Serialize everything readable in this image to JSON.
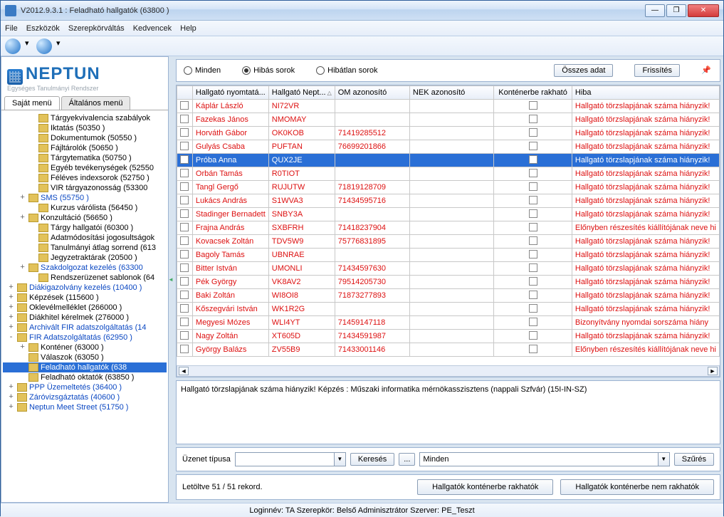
{
  "title": "V2012.9.3.1 : Feladható hallgatók (63800  )",
  "menu": [
    "File",
    "Eszközök",
    "Szerepkörváltás",
    "Kedvencek",
    "Help"
  ],
  "logo": {
    "name": "NEPTUN",
    "sub": "Egységes Tanulmányi Rendszer"
  },
  "left_tabs": {
    "active": "Saját menü",
    "inactive": "Általános menü"
  },
  "tree": [
    {
      "ind": 2,
      "tw": "",
      "label": "Tárgyekvivalencia szabályok",
      "tr": true
    },
    {
      "ind": 2,
      "tw": "",
      "label": "Iktatás (50350  )"
    },
    {
      "ind": 2,
      "tw": "",
      "label": "Dokumentumok (50550  )"
    },
    {
      "ind": 2,
      "tw": "",
      "label": "Fájltárolók (50650  )"
    },
    {
      "ind": 2,
      "tw": "",
      "label": "Tárgytematika (50750  )"
    },
    {
      "ind": 2,
      "tw": "",
      "label": "Egyéb tevékenységek (52550"
    },
    {
      "ind": 2,
      "tw": "",
      "label": "Féléves indexsorok (52750  )"
    },
    {
      "ind": 2,
      "tw": "",
      "label": "VIR tárgyazonosság (53300"
    },
    {
      "ind": 1,
      "tw": "+",
      "label": "SMS (55750  )",
      "blue": true
    },
    {
      "ind": 2,
      "tw": "",
      "label": "Kurzus várólista (56450  )"
    },
    {
      "ind": 1,
      "tw": "+",
      "label": "Konzultáció (56650  )"
    },
    {
      "ind": 2,
      "tw": "",
      "label": "Tárgy hallgatói (60300  )"
    },
    {
      "ind": 2,
      "tw": "",
      "label": "Adatmódosítási jogosultságok"
    },
    {
      "ind": 2,
      "tw": "",
      "label": "Tanulmányi átlag sorrend (613"
    },
    {
      "ind": 2,
      "tw": "",
      "label": "Jegyzetraktárak (20500  )"
    },
    {
      "ind": 1,
      "tw": "+",
      "label": "Szakdolgozat kezelés (63300",
      "blue": true
    },
    {
      "ind": 2,
      "tw": "",
      "label": "Rendszerüzenet sablonok (64"
    },
    {
      "ind": 0,
      "tw": "+",
      "label": "Diákigazolvány kezelés (10400  )",
      "blue": true
    },
    {
      "ind": 0,
      "tw": "+",
      "label": "Képzések (115600  )"
    },
    {
      "ind": 0,
      "tw": "+",
      "label": "Oklevélmelléklet (266000  )"
    },
    {
      "ind": 0,
      "tw": "+",
      "label": "Diákhitel kérelmek (276000  )"
    },
    {
      "ind": 0,
      "tw": "+",
      "label": "Archivált FIR adatszolgáltatás (14",
      "blue": true
    },
    {
      "ind": 0,
      "tw": "-",
      "label": "FIR Adatszolgáltatás (62950  )",
      "blue": true
    },
    {
      "ind": 1,
      "tw": "+",
      "label": "Konténer (63000  )"
    },
    {
      "ind": 1,
      "tw": "",
      "label": "Válaszok (63050  )"
    },
    {
      "ind": 1,
      "tw": "",
      "label": "Feladható hallgatók  (638",
      "sel": true
    },
    {
      "ind": 1,
      "tw": "",
      "label": "Feladható oktatók (63850  )"
    },
    {
      "ind": 0,
      "tw": "+",
      "label": "PPP Üzemeltetés (36400  )",
      "blue": true
    },
    {
      "ind": 0,
      "tw": "+",
      "label": "Záróvizsgáztatás (40600  )",
      "blue": true
    },
    {
      "ind": 0,
      "tw": "+",
      "label": "Neptun Meet Street (51750  )",
      "blue": true
    }
  ],
  "filters": {
    "all": "Minden",
    "bad": "Hibás sorok",
    "good": "Hibátlan sorok"
  },
  "top_buttons": {
    "alldata": "Összes adat",
    "refresh": "Frissítés"
  },
  "columns": {
    "nev": "Hallgató nyomtatá...",
    "kod": "Hallgató Nept...",
    "om": "OM azonosító",
    "nek": "NEK azonosító",
    "kont": "Konténerbe rakható",
    "hiba": "Hiba"
  },
  "rows": [
    {
      "nev": "Káplár László",
      "kod": "NI72VR",
      "om": "",
      "hiba": "Hallgató törzslapjának száma hiányzik!"
    },
    {
      "nev": "Fazekas János",
      "kod": "NMOMAY",
      "om": "",
      "hiba": "Hallgató törzslapjának száma hiányzik!"
    },
    {
      "nev": "Horváth Gábor",
      "kod": "OK0KOB",
      "om": "71419285512",
      "hiba": "Hallgató törzslapjának száma hiányzik!"
    },
    {
      "nev": "Gulyás Csaba",
      "kod": "PUFTAN",
      "om": "76699201866",
      "hiba": "Hallgató törzslapjának száma hiányzik!"
    },
    {
      "nev": "Próba Anna",
      "kod": "QUX2JE",
      "om": "",
      "hiba": "Hallgató törzslapjának száma hiányzik!",
      "sel": true
    },
    {
      "nev": "Orbán Tamás",
      "kod": "R0TIOT",
      "om": "",
      "hiba": "Hallgató törzslapjának száma hiányzik!"
    },
    {
      "nev": "Tangl Gergő",
      "kod": "RUJUTW",
      "om": "71819128709",
      "hiba": "Hallgató törzslapjának száma hiányzik!"
    },
    {
      "nev": "Lukács András",
      "kod": "S1WVA3",
      "om": "71434595716",
      "hiba": "Hallgató törzslapjának száma hiányzik!"
    },
    {
      "nev": "Stadinger Bernadett",
      "kod": "SNBY3A",
      "om": "",
      "hiba": "Hallgató törzslapjának száma hiányzik!"
    },
    {
      "nev": "Frajna András",
      "kod": "SXBFRH",
      "om": "71418237904",
      "hiba": "Előnyben részesítés kiállítójának neve hi"
    },
    {
      "nev": "Kovacsek Zoltán",
      "kod": "TDV5W9",
      "om": "75776831895",
      "hiba": "Hallgató törzslapjának száma hiányzik!"
    },
    {
      "nev": "Bagoly Tamás",
      "kod": "UBNRAE",
      "om": "",
      "hiba": "Hallgató törzslapjának száma hiányzik!"
    },
    {
      "nev": "Bitter István",
      "kod": "UMONLI",
      "om": "71434597630",
      "hiba": "Hallgató törzslapjának száma hiányzik!"
    },
    {
      "nev": "Pék György",
      "kod": "VK8AV2",
      "om": "79514205730",
      "hiba": "Hallgató törzslapjának száma hiányzik!"
    },
    {
      "nev": "Baki Zoltán",
      "kod": "WI8OI8",
      "om": "71873277893",
      "hiba": "Hallgató törzslapjának száma hiányzik!"
    },
    {
      "nev": "Kőszegvári István",
      "kod": "WK1R2G",
      "om": "",
      "hiba": "Hallgató törzslapjának száma hiányzik!"
    },
    {
      "nev": "Megyesi Mózes",
      "kod": "WLI4YT",
      "om": "71459147118",
      "hiba": "Bizonyítvány nyomdai sorszáma hiány"
    },
    {
      "nev": "Nagy Zoltán",
      "kod": "XT605D",
      "om": "71434591987",
      "hiba": "Hallgató törzslapjának száma hiányzik!"
    },
    {
      "nev": "György Balázs",
      "kod": "ZV55B9",
      "om": "71433001146",
      "hiba": "Előnyben részesítés kiállítójának neve hi"
    }
  ],
  "detail_text": "Hallgató törzslapjának száma hiányzik! Képzés : Műszaki informatika  mérnökasszisztens (nappali Szfvár) (15I-IN-SZ)",
  "search": {
    "label": "Üzenet típusa",
    "btn": "Keresés",
    "more": "...",
    "filter_val": "Minden",
    "filter_btn": "Szűrés"
  },
  "footer": {
    "count": "Letöltve 51 / 51 rekord.",
    "btn1": "Hallgatók konténerbe rakhatók",
    "btn2": "Hallgatók konténerbe nem rakhatók"
  },
  "status": "Loginnév: TA   Szerepkör: Belső Adminisztrátor   Szerver: PE_Teszt"
}
